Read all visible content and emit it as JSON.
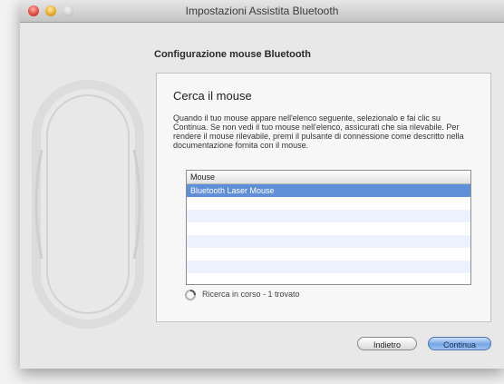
{
  "window": {
    "title": "Impostazioni Assistita Bluetooth"
  },
  "header": {
    "heading": "Configurazione mouse Bluetooth"
  },
  "panel": {
    "section_title": "Cerca il mouse",
    "description": "Quando il tuo mouse appare nell'elenco seguente, selezionalo e fai clic su Continua. Se non vedi il tuo mouse nell'elenco, assicurati che sia rilevabile. Per rendere il mouse rilevabile, premi il pulsante di connessione come descritto nella documentazione fornita con il mouse."
  },
  "device_list": {
    "header": "Mouse",
    "items": [
      "Bluetooth Laser Mouse"
    ]
  },
  "status": {
    "text": "Ricerca in corso - 1 trovato"
  },
  "buttons": {
    "back_label": "Indietro",
    "continue_label": "Continua"
  },
  "colors": {
    "selection": "#5f8fd6",
    "default_button": "#76a6e6"
  }
}
